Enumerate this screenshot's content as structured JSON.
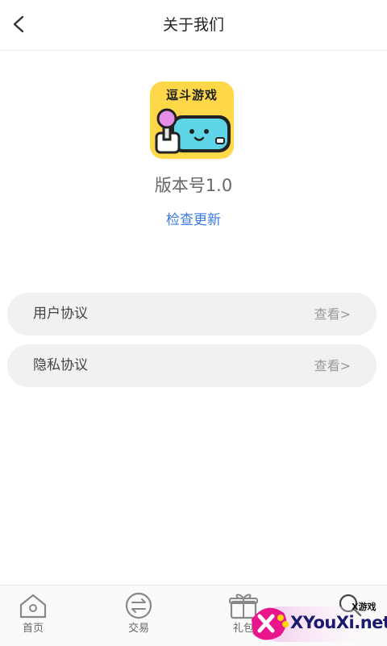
{
  "header": {
    "title": "关于我们"
  },
  "app": {
    "icon_text": "逗斗游戏",
    "version": "版本号1.0",
    "check_update": "检查更新"
  },
  "rows": [
    {
      "label": "用户协议",
      "action": "查看>"
    },
    {
      "label": "隐私协议",
      "action": "查看>"
    }
  ],
  "tabs": [
    {
      "label": "首页",
      "icon": "home-icon"
    },
    {
      "label": "交易",
      "icon": "trade-icon"
    },
    {
      "label": "礼包",
      "icon": "gift-icon"
    },
    {
      "label": "",
      "icon": "search-icon"
    }
  ],
  "watermark": {
    "small": "X游戏",
    "big": "XYouXi.net"
  },
  "colors": {
    "accent_link": "#3b7ae0",
    "icon_bg": "#ffd84a",
    "row_bg": "#f1f1f1"
  }
}
